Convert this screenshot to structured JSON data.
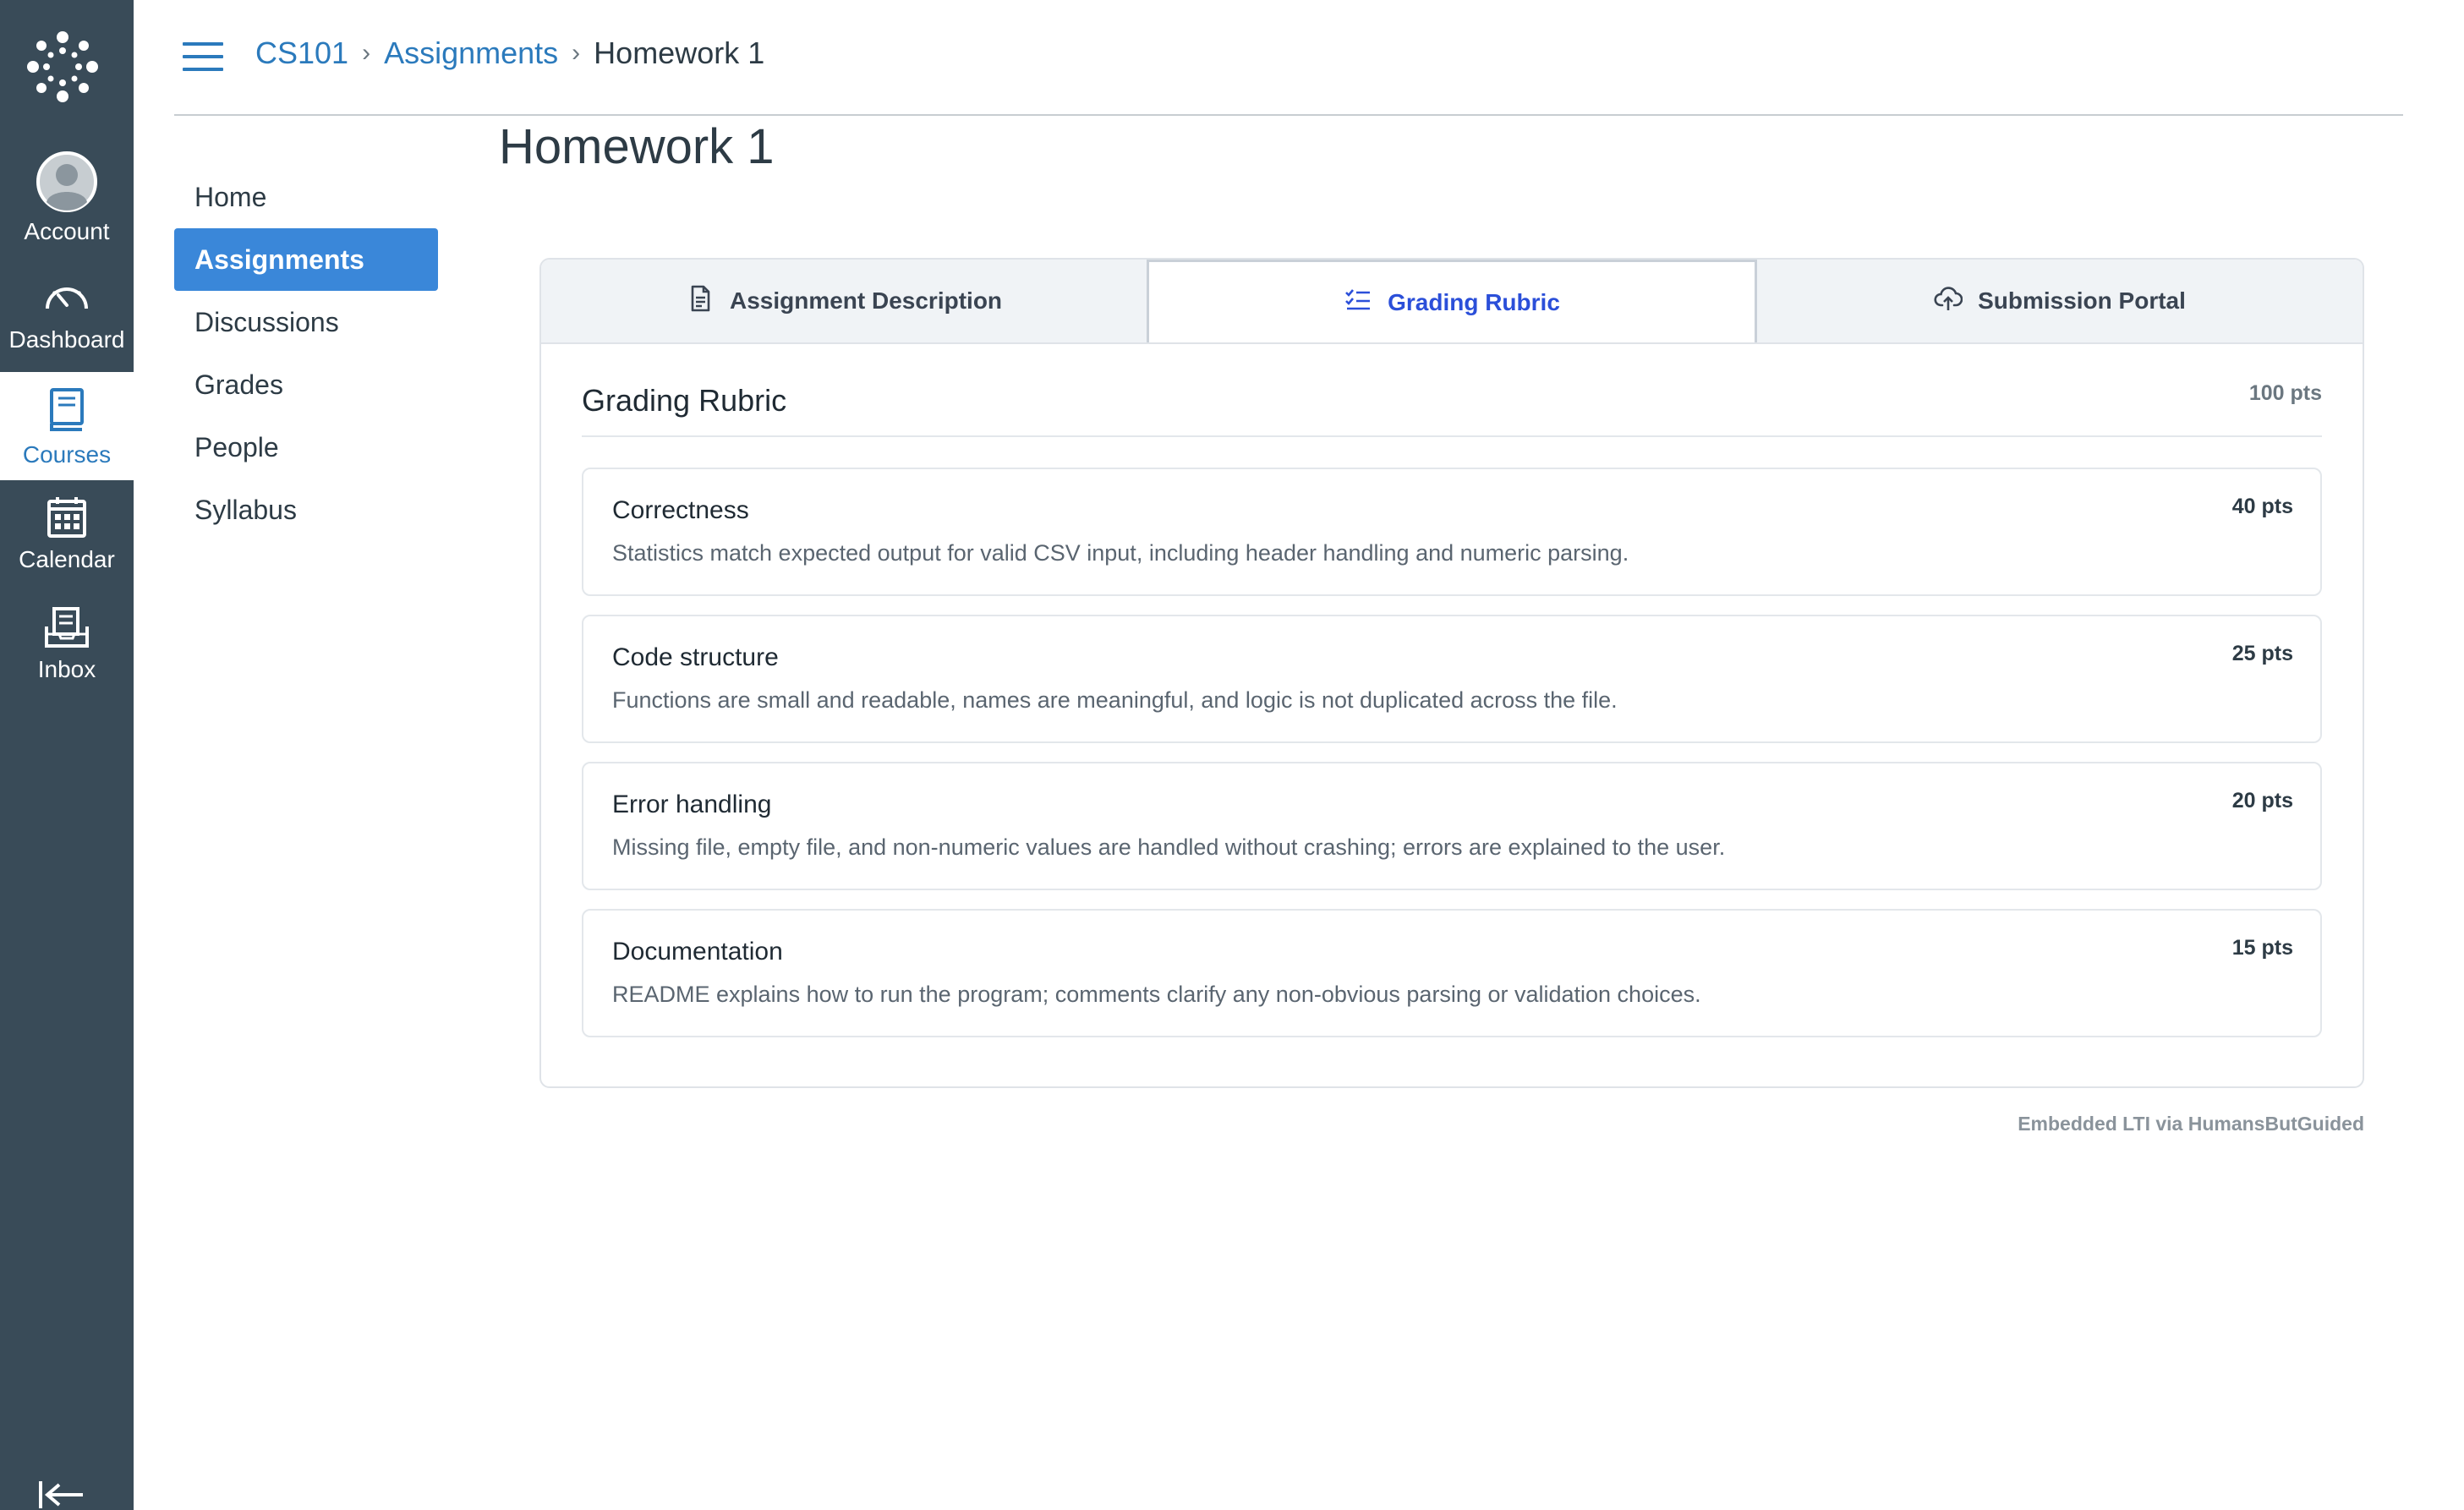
{
  "global_nav": {
    "items": [
      {
        "label": "Account",
        "icon": "account-avatar-icon"
      },
      {
        "label": "Dashboard",
        "icon": "dashboard-gauge-icon"
      },
      {
        "label": "Courses",
        "icon": "courses-book-icon",
        "active": true
      },
      {
        "label": "Calendar",
        "icon": "calendar-icon"
      },
      {
        "label": "Inbox",
        "icon": "inbox-icon"
      }
    ]
  },
  "breadcrumb": {
    "course": "CS101",
    "section": "Assignments",
    "current": "Homework 1",
    "separator": "›"
  },
  "course_nav": {
    "items": [
      {
        "label": "Home"
      },
      {
        "label": "Assignments",
        "active": true
      },
      {
        "label": "Discussions"
      },
      {
        "label": "Grades"
      },
      {
        "label": "People"
      },
      {
        "label": "Syllabus"
      }
    ]
  },
  "page_title": "Homework 1",
  "tool": {
    "tabs": [
      {
        "label": "Assignment Description",
        "icon": "document-icon"
      },
      {
        "label": "Grading Rubric",
        "icon": "checklist-icon",
        "active": true
      },
      {
        "label": "Submission Portal",
        "icon": "cloud-upload-icon"
      }
    ],
    "rubric": {
      "title": "Grading Rubric",
      "total": "100 pts",
      "criteria": [
        {
          "name": "Correctness",
          "points": "40 pts",
          "description": "Statistics match expected output for valid CSV input, including header handling and numeric parsing."
        },
        {
          "name": "Code structure",
          "points": "25 pts",
          "description": "Functions are small and readable, names are meaningful, and logic is not duplicated across the file."
        },
        {
          "name": "Error handling",
          "points": "20 pts",
          "description": "Missing file, empty file, and non-numeric values are handled without crashing; errors are explained to the user."
        },
        {
          "name": "Documentation",
          "points": "15 pts",
          "description": "README explains how to run the program; comments clarify any non-obvious parsing or validation choices."
        }
      ]
    },
    "footer": "Embedded LTI via HumansButGuided"
  },
  "colors": {
    "nav_bg": "#394b58",
    "link": "#2b7abc",
    "active_course_nav": "#3a87d9",
    "active_tab_text": "#2b4fd9"
  }
}
